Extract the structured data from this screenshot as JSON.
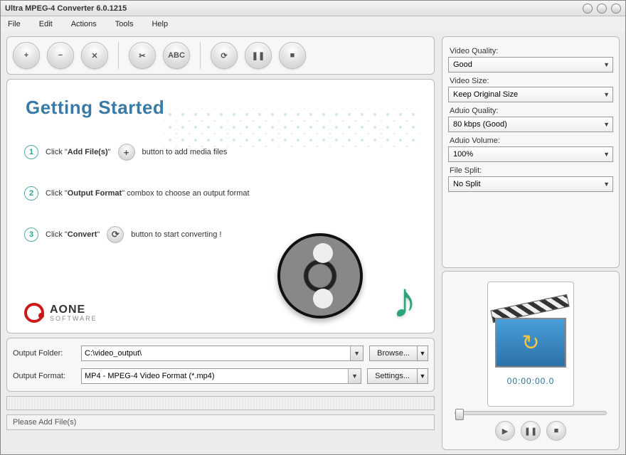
{
  "window": {
    "title": "Ultra MPEG-4 Converter 6.0.1215"
  },
  "menu": {
    "file": "File",
    "edit": "Edit",
    "actions": "Actions",
    "tools": "Tools",
    "help": "Help"
  },
  "toolbar": {
    "add": "+",
    "remove": "−",
    "clear": "✕",
    "cut": "✂",
    "abc": "ABC",
    "convert": "⟳",
    "pause": "❚❚",
    "stop": "■"
  },
  "getting_started": {
    "title": "Getting Started",
    "step1_pre": "Click \"",
    "step1_bold": "Add File(s)",
    "step1_post": "\"",
    "step1_tail": "button to add media files",
    "step2_pre": "Click \"",
    "step2_bold": "Output Format",
    "step2_post": "\" combox to choose an output format",
    "step3_pre": "Click \"",
    "step3_bold": "Convert",
    "step3_post": "\"",
    "step3_tail": "button to start converting !"
  },
  "brand": {
    "line1": "AONE",
    "line2": "SOFTWARE"
  },
  "output": {
    "folder_label": "Output Folder:",
    "folder_value": "C:\\video_output\\",
    "format_label": "Output Format:",
    "format_value": "MP4 - MPEG-4 Video Format (*.mp4)",
    "browse": "Browse...",
    "settings": "Settings..."
  },
  "status": {
    "text": "Please Add File(s)"
  },
  "settings": {
    "video_quality_label": "Video Quality:",
    "video_quality_value": "Good",
    "video_size_label": "Video Size:",
    "video_size_value": "Keep Original Size",
    "audio_quality_label": "Aduio Quality:",
    "audio_quality_value": "80  kbps (Good)",
    "audio_volume_label": "Aduio Volume:",
    "audio_volume_value": "100%",
    "file_split_label": "File Split:",
    "file_split_value": "No Split"
  },
  "preview": {
    "timecode": "00:00:00.0"
  }
}
